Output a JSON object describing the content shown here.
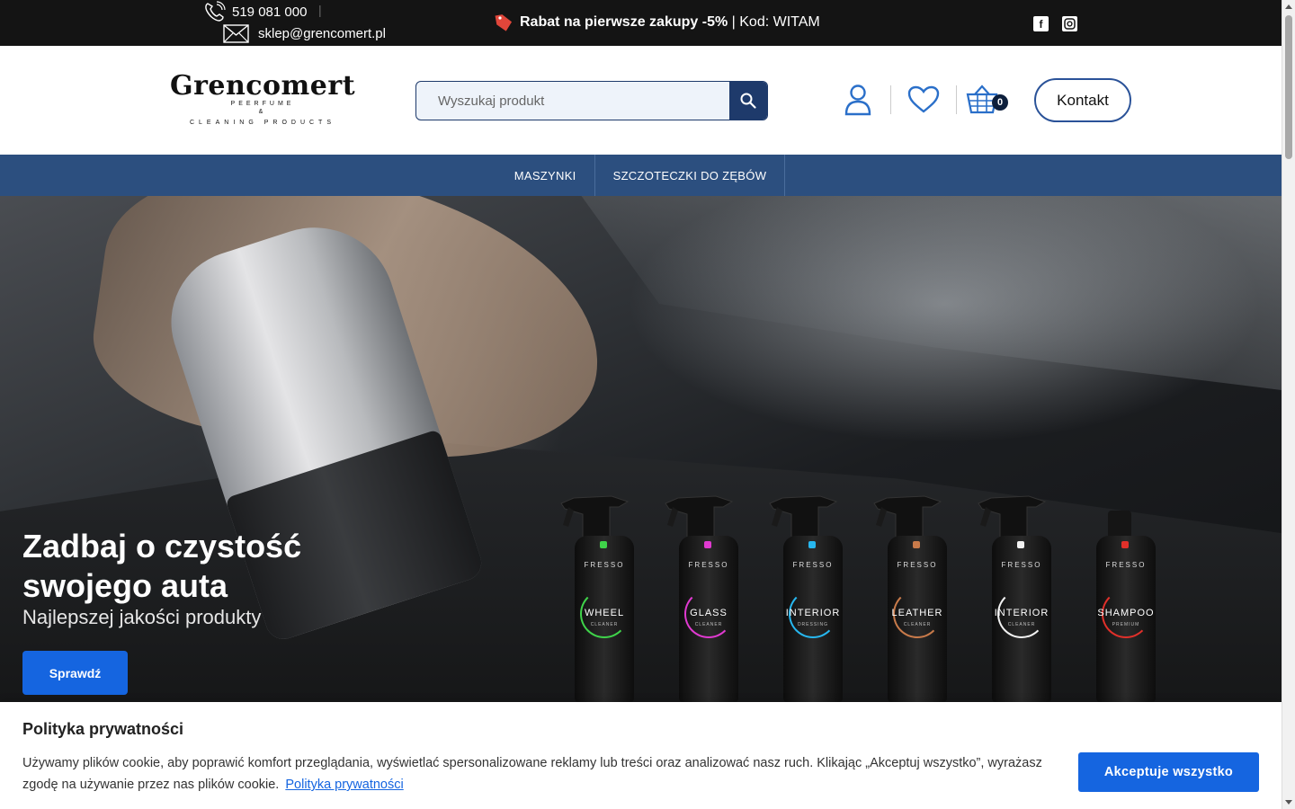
{
  "topbar": {
    "phone": "519 081 000",
    "separator": "|",
    "email": "sklep@grencomert.pl",
    "promo_bold": "Rabat na pierwsze zakupy -5%",
    "promo_rest": "| Kod: WITAM",
    "social_icons": [
      "facebook-icon",
      "instagram-icon"
    ]
  },
  "header": {
    "logo_brand": "Grencomert",
    "logo_sub1": "PEERFUME",
    "logo_amp": "&",
    "logo_sub2": "CLEANING PRODUCTS",
    "search_placeholder": "Wyszukaj produkt",
    "cart_count": "0",
    "contact_label": "Kontakt"
  },
  "nav": {
    "items": [
      "MASZYNKI",
      "SZCZOTECZKI DO ZĘBÓW"
    ]
  },
  "hero": {
    "title": "Zadbaj o czystość swojego auta",
    "subtitle": "Najlepszej jakości produkty",
    "cta": "Sprawdź",
    "products": [
      {
        "brand": "FRESSO",
        "name": "WHEEL",
        "type": "CLEANER",
        "color": "#3fd34a"
      },
      {
        "brand": "FRESSO",
        "name": "GLASS",
        "type": "CLEANER",
        "color": "#e03ad0"
      },
      {
        "brand": "FRESSO",
        "name": "INTERIOR",
        "type": "DRESSING",
        "color": "#27b7ef"
      },
      {
        "brand": "FRESSO",
        "name": "LEATHER",
        "type": "CLEANER",
        "color": "#c87a4a"
      },
      {
        "brand": "FRESSO",
        "name": "INTERIOR",
        "type": "CLEANER",
        "color": "#f2f2f2"
      },
      {
        "brand": "FRESSO",
        "name": "SHAMPOO",
        "type": "PREMIUM",
        "color": "#e0302a"
      }
    ]
  },
  "cookie": {
    "title": "Polityka prywatności",
    "text": "Używamy plików cookie, aby poprawić komfort przeglądania, wyświetlać spersonalizowane reklamy lub treści oraz analizować nasz ruch. Klikając „Akceptuj wszystko”, wyrażasz zgodę na używanie przez nas plików cookie.",
    "link": "Polityka prywatności",
    "accept": "Akceptuje wszystko"
  },
  "colors": {
    "topbar_bg": "#141414",
    "nav_bg": "#2c4f7f",
    "primary": "#1565e0",
    "search_btn": "#1e3a6b"
  }
}
